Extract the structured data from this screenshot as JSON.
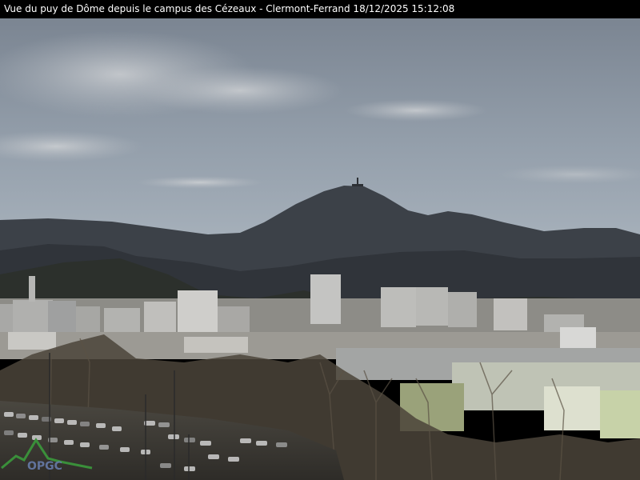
{
  "caption": {
    "text": "Vue du puy de Dôme depuis le campus des Cézeaux - Clermont-Ferrand 18/12/2025 15:12:08"
  },
  "scene": {
    "subjects": [
      "sky",
      "clouds",
      "puy-de-dome-summit",
      "summit-antenna",
      "mountain-ridge",
      "hills",
      "city-buildings",
      "bare-trees",
      "parking-lot",
      "parked-cars"
    ],
    "colors": {
      "sky_top": "#7e8794",
      "sky_bottom": "#a7b2bd",
      "cloud": "#c9cdd2",
      "mountain": "#3c4148",
      "hills": "#2f3331",
      "buildings": "#b9b8b6",
      "trees": "#4d4539",
      "ground": "#3b3933"
    }
  },
  "watermark": {
    "text": "OPGC",
    "color": "#3a8f3a"
  }
}
